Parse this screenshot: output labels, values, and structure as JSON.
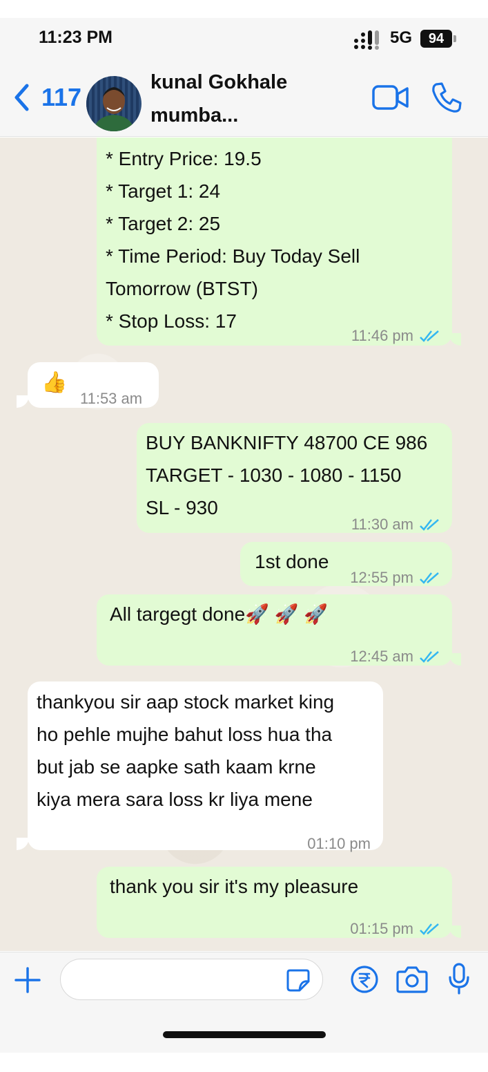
{
  "status_bar": {
    "time": "11:23 PM",
    "network": "5G",
    "battery": "94"
  },
  "header": {
    "back_count": "117",
    "contact_name": "kunal Gokhale",
    "contact_subtitle": "mumba...",
    "accent_color": "#1a73e8"
  },
  "messages": [
    {
      "direction": "out",
      "text": "* Entry Price: 19.5\n* Target 1:  24\n* Target 2:  25\n* Time Period: Buy Today Sell\nTomorrow (BTST)\n* Stop Loss: 17",
      "time": "11:46 pm",
      "read": true
    },
    {
      "direction": "in",
      "text": "👍",
      "time": "11:53 am"
    },
    {
      "direction": "out",
      "text": " BUY BANKNIFTY 48700 CE 986\nTARGET - 1030 - 1080 - 1150\nSL - 930",
      "time": "11:30 am",
      "read": true
    },
    {
      "direction": "out",
      "text": "1st done",
      "time": "12:55 pm",
      "read": true
    },
    {
      "direction": "out",
      "text": "All targegt done🚀 🚀 🚀",
      "time": "12:45 am",
      "read": true
    },
    {
      "direction": "in",
      "text": " thankyou sir aap  stock market king\nho pehle mujhe bahut loss hua tha\nbut jab se aapke sath kaam krne\nkiya mera sara loss kr liya mene",
      "time": "01:10 pm"
    },
    {
      "direction": "out",
      "text": "thank you sir  it's my pleasure",
      "time": "01:15 pm",
      "read": true
    }
  ],
  "input": {
    "value": "",
    "placeholder": ""
  },
  "colors": {
    "outgoing_bubble": "#e2fbd4",
    "incoming_bubble": "#ffffff",
    "read_tick": "#34b7f1",
    "chat_background": "#efeae2"
  },
  "icons": {
    "back": "chevron-left-icon",
    "video": "video-camera-icon",
    "call": "phone-icon",
    "attach": "plus-icon",
    "sticker": "sticker-icon",
    "payment": "rupee-icon",
    "camera": "camera-icon",
    "mic": "microphone-icon"
  }
}
